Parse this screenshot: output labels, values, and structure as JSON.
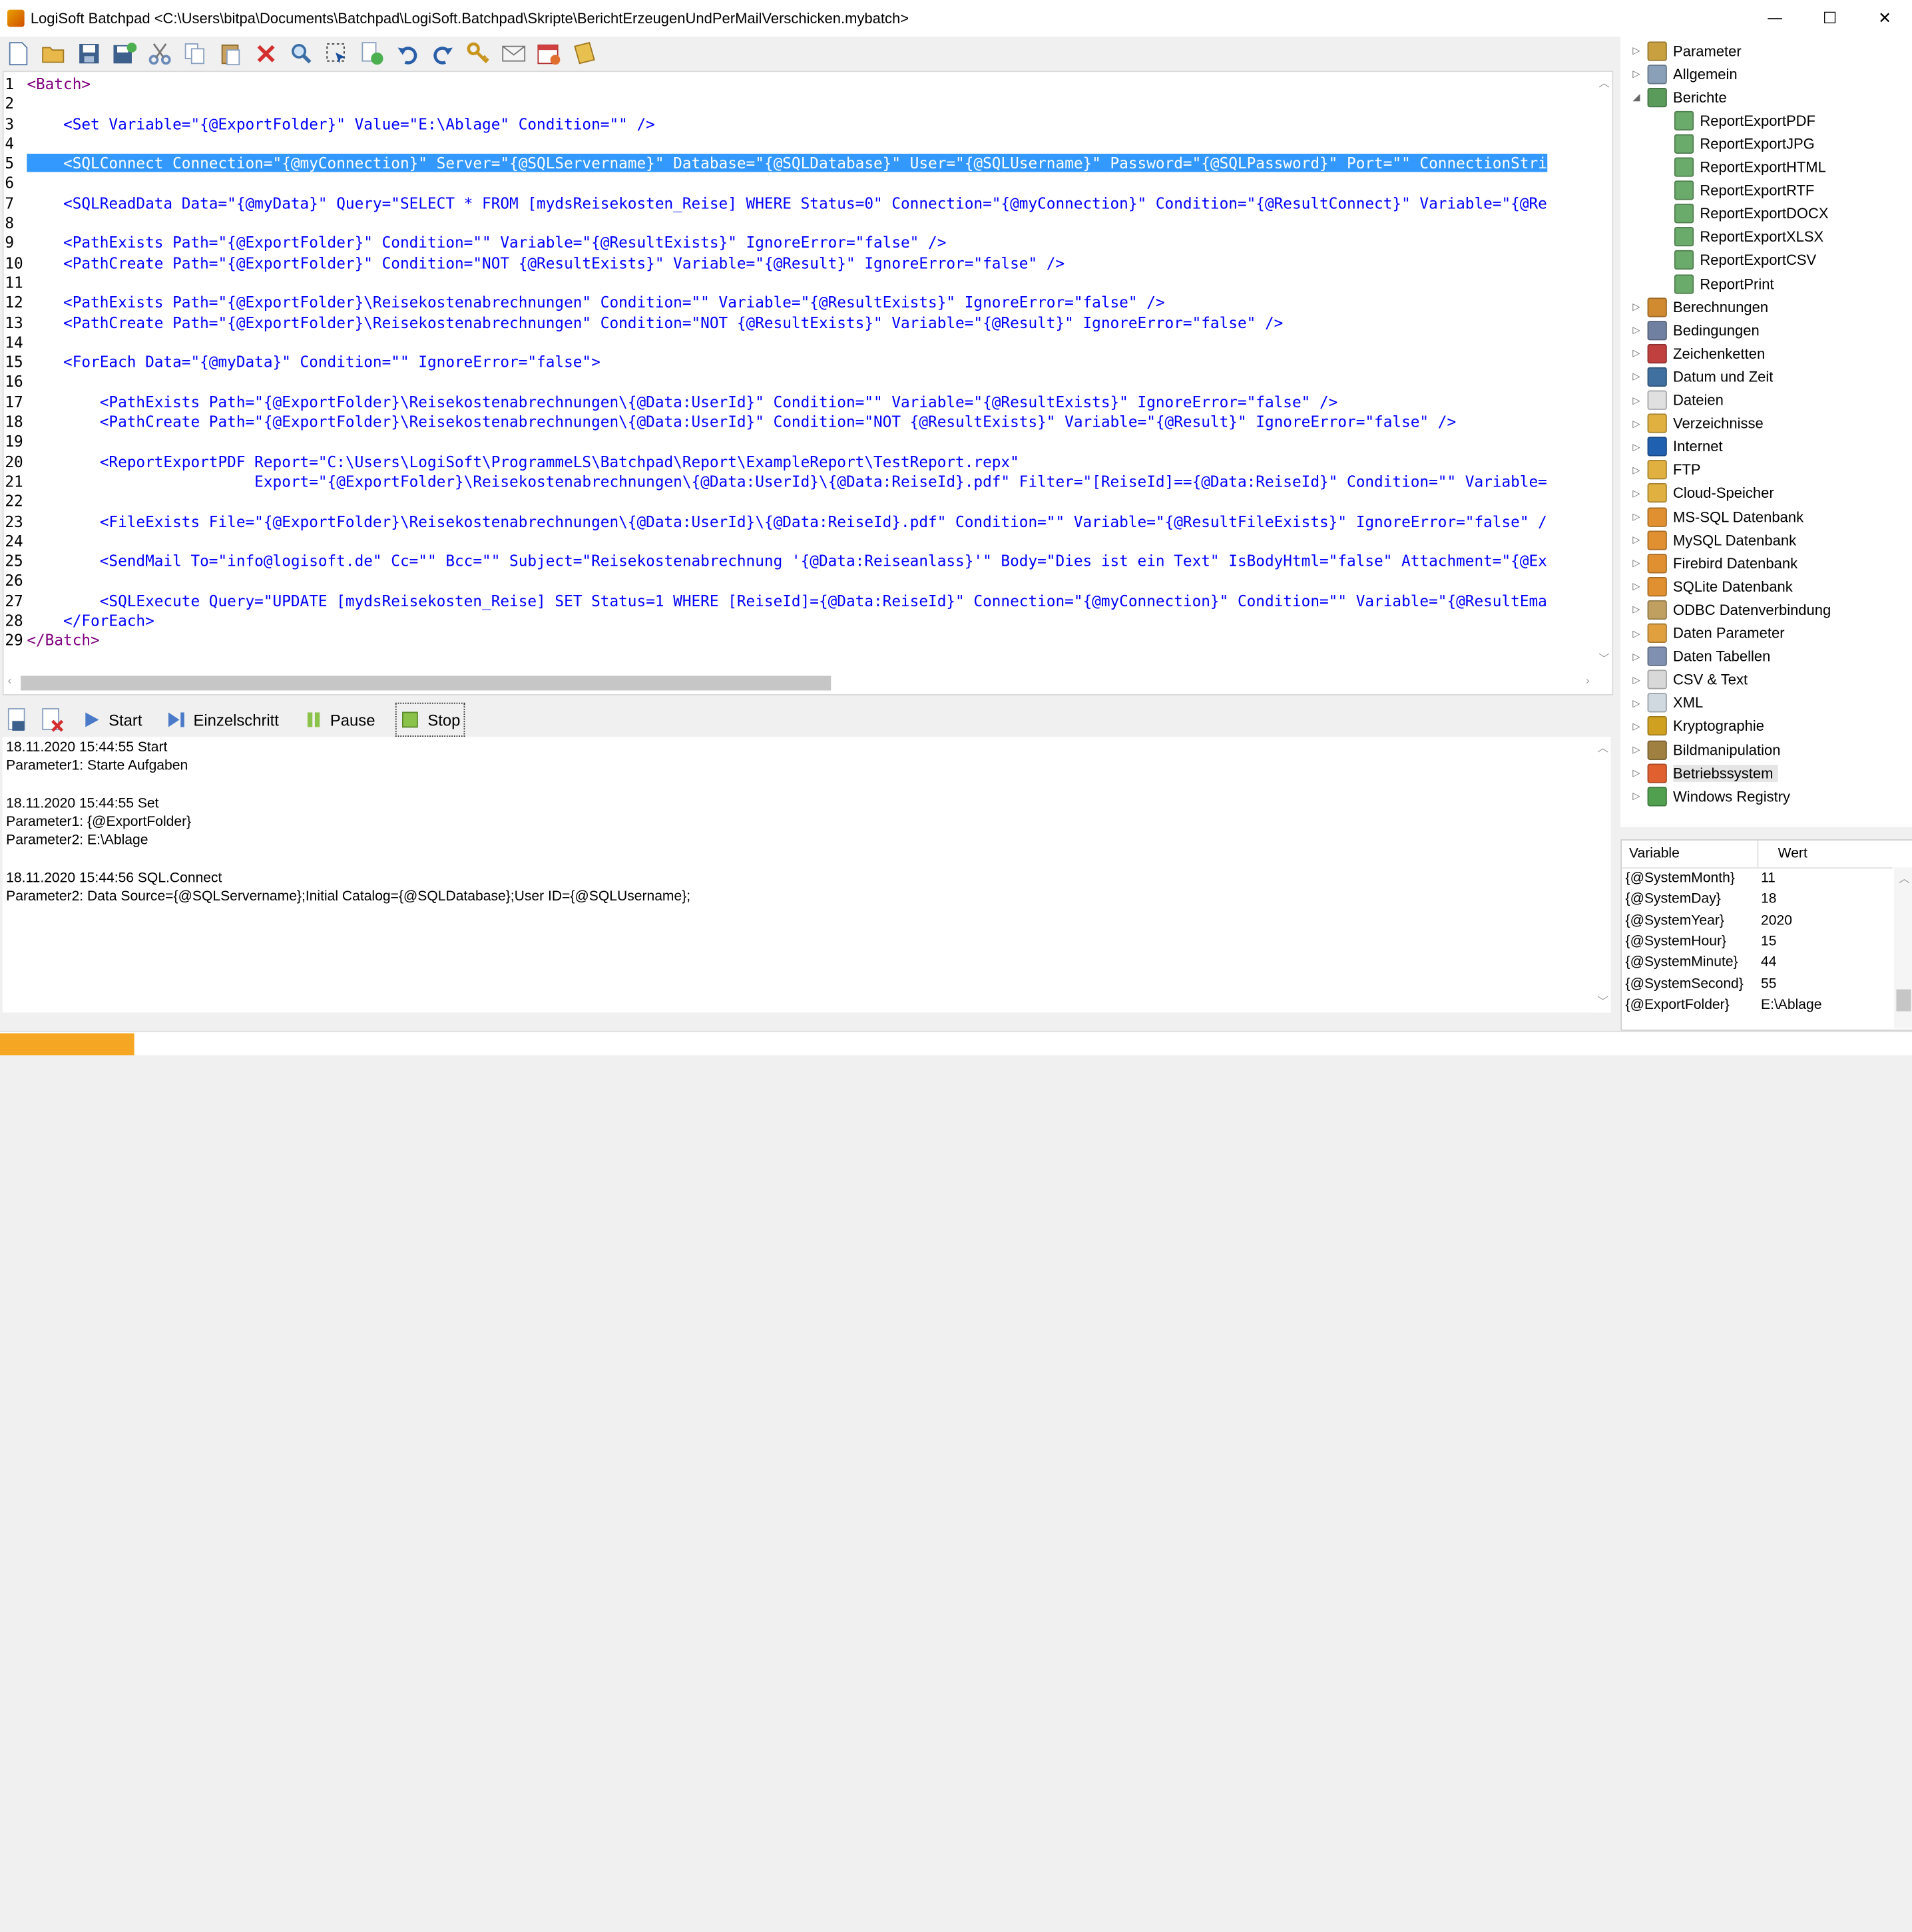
{
  "window": {
    "title": "LogiSoft Batchpad <C:\\Users\\bitpa\\Documents\\Batchpad\\LogiSoft.Batchpad\\Skripte\\BerichtErzeugenUndPerMailVerschicken.mybatch>",
    "minimize_glyph": "—",
    "maximize_glyph": "☐",
    "close_glyph": "✕"
  },
  "toolbar": {
    "icons": [
      "new-file-icon",
      "open-folder-icon",
      "save-icon",
      "save-as-icon",
      "cut-icon",
      "copy-icon",
      "paste-icon",
      "delete-icon",
      "search-icon",
      "select-icon",
      "add-page-icon",
      "undo-icon",
      "redo-icon",
      "keys-icon",
      "mail-icon",
      "calendar-icon",
      "notes-icon"
    ]
  },
  "editor": {
    "lines": [
      {
        "n": "1",
        "text": "<Batch>"
      },
      {
        "n": "2",
        "text": ""
      },
      {
        "n": "3",
        "text": "    <Set Variable=\"{@ExportFolder}\" Value=\"E:\\Ablage\" Condition=\"\" />"
      },
      {
        "n": "4",
        "text": ""
      },
      {
        "n": "5",
        "text": "    <SQLConnect Connection=\"{@myConnection}\" Server=\"{@SQLServername}\" Database=\"{@SQLDatabase}\" User=\"{@SQLUsername}\" Password=\"{@SQLPassword}\" Port=\"\" ConnectionStri",
        "selected": true
      },
      {
        "n": "6",
        "text": ""
      },
      {
        "n": "7",
        "text": "    <SQLReadData Data=\"{@myData}\" Query=\"SELECT * FROM [mydsReisekosten_Reise] WHERE Status=0\" Connection=\"{@myConnection}\" Condition=\"{@ResultConnect}\" Variable=\"{@Re"
      },
      {
        "n": "8",
        "text": ""
      },
      {
        "n": "9",
        "text": "    <PathExists Path=\"{@ExportFolder}\" Condition=\"\" Variable=\"{@ResultExists}\" IgnoreError=\"false\" />"
      },
      {
        "n": "10",
        "text": "    <PathCreate Path=\"{@ExportFolder}\" Condition=\"NOT {@ResultExists}\" Variable=\"{@Result}\" IgnoreError=\"false\" />"
      },
      {
        "n": "11",
        "text": ""
      },
      {
        "n": "12",
        "text": "    <PathExists Path=\"{@ExportFolder}\\Reisekostenabrechnungen\" Condition=\"\" Variable=\"{@ResultExists}\" IgnoreError=\"false\" />"
      },
      {
        "n": "13",
        "text": "    <PathCreate Path=\"{@ExportFolder}\\Reisekostenabrechnungen\" Condition=\"NOT {@ResultExists}\" Variable=\"{@Result}\" IgnoreError=\"false\" />"
      },
      {
        "n": "14",
        "text": ""
      },
      {
        "n": "15",
        "text": "    <ForEach Data=\"{@myData}\" Condition=\"\" IgnoreError=\"false\">"
      },
      {
        "n": "16",
        "text": ""
      },
      {
        "n": "17",
        "text": "        <PathExists Path=\"{@ExportFolder}\\Reisekostenabrechnungen\\{@Data:UserId}\" Condition=\"\" Variable=\"{@ResultExists}\" IgnoreError=\"false\" />"
      },
      {
        "n": "18",
        "text": "        <PathCreate Path=\"{@ExportFolder}\\Reisekostenabrechnungen\\{@Data:UserId}\" Condition=\"NOT {@ResultExists}\" Variable=\"{@Result}\" IgnoreError=\"false\" />"
      },
      {
        "n": "19",
        "text": ""
      },
      {
        "n": "20",
        "text": "        <ReportExportPDF Report=\"C:\\Users\\LogiSoft\\ProgrammeLS\\Batchpad\\Report\\ExampleReport\\TestReport.repx\""
      },
      {
        "n": "21",
        "text": "                         Export=\"{@ExportFolder}\\Reisekostenabrechnungen\\{@Data:UserId}\\{@Data:ReiseId}.pdf\" Filter=\"[ReiseId]=={@Data:ReiseId}\" Condition=\"\" Variable="
      },
      {
        "n": "22",
        "text": ""
      },
      {
        "n": "23",
        "text": "        <FileExists File=\"{@ExportFolder}\\Reisekostenabrechnungen\\{@Data:UserId}\\{@Data:ReiseId}.pdf\" Condition=\"\" Variable=\"{@ResultFileExists}\" IgnoreError=\"false\" /"
      },
      {
        "n": "24",
        "text": ""
      },
      {
        "n": "25",
        "text": "        <SendMail To=\"info@logisoft.de\" Cc=\"\" Bcc=\"\" Subject=\"Reisekostenabrechnung '{@Data:Reiseanlass}'\" Body=\"Dies ist ein Text\" IsBodyHtml=\"false\" Attachment=\"{@Ex"
      },
      {
        "n": "26",
        "text": ""
      },
      {
        "n": "27",
        "text": "        <SQLExecute Query=\"UPDATE [mydsReisekosten_Reise] SET Status=1 WHERE [ReiseId]={@Data:ReiseId}\" Connection=\"{@myConnection}\" Condition=\"\" Variable=\"{@ResultEma"
      },
      {
        "n": "28",
        "text": "    </ForEach>"
      },
      {
        "n": "29",
        "text": "</Batch>"
      }
    ]
  },
  "debug_toolbar": {
    "start_label": "Start",
    "step_label": "Einzelschritt",
    "pause_label": "Pause",
    "stop_label": "Stop"
  },
  "log": {
    "lines": [
      "18.11.2020 15:44:55 Start",
      "Parameter1: Starte Aufgaben",
      "",
      "18.11.2020 15:44:55 Set",
      "Parameter1: {@ExportFolder}",
      "Parameter2: E:\\Ablage",
      "",
      "18.11.2020 15:44:56 SQL.Connect",
      "Parameter2: Data Source={@SQLServername};Initial Catalog={@SQLDatabase};User ID={@SQLUsername};"
    ]
  },
  "tree": {
    "nodes": [
      {
        "label": "Parameter",
        "level": 0,
        "expander": "▷",
        "icon": "parameter-icon",
        "color": "#c8a040"
      },
      {
        "label": "Allgemein",
        "level": 0,
        "expander": "▷",
        "icon": "general-icon",
        "color": "#8aa0b8"
      },
      {
        "label": "Berichte",
        "level": 0,
        "expander": "◢",
        "icon": "reports-icon",
        "color": "#5a9a5a"
      },
      {
        "label": "ReportExportPDF",
        "level": 1,
        "expander": "",
        "icon": "report-icon",
        "color": "#6aaa6a"
      },
      {
        "label": "ReportExportJPG",
        "level": 1,
        "expander": "",
        "icon": "report-icon",
        "color": "#6aaa6a"
      },
      {
        "label": "ReportExportHTML",
        "level": 1,
        "expander": "",
        "icon": "report-icon",
        "color": "#6aaa6a"
      },
      {
        "label": "ReportExportRTF",
        "level": 1,
        "expander": "",
        "icon": "report-icon",
        "color": "#6aaa6a"
      },
      {
        "label": "ReportExportDOCX",
        "level": 1,
        "expander": "",
        "icon": "report-icon",
        "color": "#6aaa6a"
      },
      {
        "label": "ReportExportXLSX",
        "level": 1,
        "expander": "",
        "icon": "report-icon",
        "color": "#6aaa6a"
      },
      {
        "label": "ReportExportCSV",
        "level": 1,
        "expander": "",
        "icon": "report-icon",
        "color": "#6aaa6a"
      },
      {
        "label": "ReportPrint",
        "level": 1,
        "expander": "",
        "icon": "report-icon",
        "color": "#6aaa6a"
      },
      {
        "label": "Berechnungen",
        "level": 0,
        "expander": "▷",
        "icon": "sigma-icon",
        "color": "#d08a30"
      },
      {
        "label": "Bedingungen",
        "level": 0,
        "expander": "▷",
        "icon": "conditions-icon",
        "color": "#7080a0"
      },
      {
        "label": "Zeichenketten",
        "level": 0,
        "expander": "▷",
        "icon": "strings-icon",
        "color": "#c04040"
      },
      {
        "label": "Datum und Zeit",
        "level": 0,
        "expander": "▷",
        "icon": "clock-icon",
        "color": "#4070a0"
      },
      {
        "label": "Dateien",
        "level": 0,
        "expander": "▷",
        "icon": "file-icon",
        "color": "#e0e0e0"
      },
      {
        "label": "Verzeichnisse",
        "level": 0,
        "expander": "▷",
        "icon": "folder-icon",
        "color": "#e0b040"
      },
      {
        "label": "Internet",
        "level": 0,
        "expander": "▷",
        "icon": "globe-icon",
        "color": "#2060b0"
      },
      {
        "label": "FTP",
        "level": 0,
        "expander": "▷",
        "icon": "ftp-folder-icon",
        "color": "#e0b040"
      },
      {
        "label": "Cloud-Speicher",
        "level": 0,
        "expander": "▷",
        "icon": "cloud-folder-icon",
        "color": "#e0b040"
      },
      {
        "label": "MS-SQL Datenbank",
        "level": 0,
        "expander": "▷",
        "icon": "database-icon",
        "color": "#e09030"
      },
      {
        "label": "MySQL Datenbank",
        "level": 0,
        "expander": "▷",
        "icon": "database-icon",
        "color": "#e09030"
      },
      {
        "label": "Firebird Datenbank",
        "level": 0,
        "expander": "▷",
        "icon": "database-icon",
        "color": "#e09030"
      },
      {
        "label": "SQLite Datenbank",
        "level": 0,
        "expander": "▷",
        "icon": "database-icon",
        "color": "#e09030"
      },
      {
        "label": "ODBC Datenverbindung",
        "level": 0,
        "expander": "▷",
        "icon": "odbc-icon",
        "color": "#c0a060"
      },
      {
        "label": "Daten Parameter",
        "level": 0,
        "expander": "▷",
        "icon": "data-parameter-icon",
        "color": "#e0a040"
      },
      {
        "label": "Daten Tabellen",
        "level": 0,
        "expander": "▷",
        "icon": "table-icon",
        "color": "#8090b0"
      },
      {
        "label": "CSV & Text",
        "level": 0,
        "expander": "▷",
        "icon": "text-file-icon",
        "color": "#d8d8d8"
      },
      {
        "label": "XML",
        "level": 0,
        "expander": "▷",
        "icon": "xml-icon",
        "color": "#d0d8e0"
      },
      {
        "label": "Kryptographie",
        "level": 0,
        "expander": "▷",
        "icon": "lock-icon",
        "color": "#d0a020"
      },
      {
        "label": "Bildmanipulation",
        "level": 0,
        "expander": "▷",
        "icon": "image-icon",
        "color": "#a08040"
      },
      {
        "label": "Betriebssystem",
        "level": 0,
        "expander": "▷",
        "icon": "windows-icon",
        "color": "#e06030",
        "selected": true
      },
      {
        "label": "Windows Registry",
        "level": 0,
        "expander": "▷",
        "icon": "registry-icon",
        "color": "#50a050"
      }
    ]
  },
  "variables": {
    "header_variable": "Variable",
    "header_value": "Wert",
    "rows": [
      {
        "name": "{@SystemMonth}",
        "value": "11"
      },
      {
        "name": "{@SystemDay}",
        "value": "18"
      },
      {
        "name": "{@SystemYear}",
        "value": "2020"
      },
      {
        "name": "{@SystemHour}",
        "value": "15"
      },
      {
        "name": "{@SystemMinute}",
        "value": "44"
      },
      {
        "name": "{@SystemSecond}",
        "value": "55"
      },
      {
        "name": "{@ExportFolder}",
        "value": "E:\\Ablage"
      }
    ]
  },
  "status": {
    "progress": 0.07,
    "progress_color": "#f5a623"
  }
}
